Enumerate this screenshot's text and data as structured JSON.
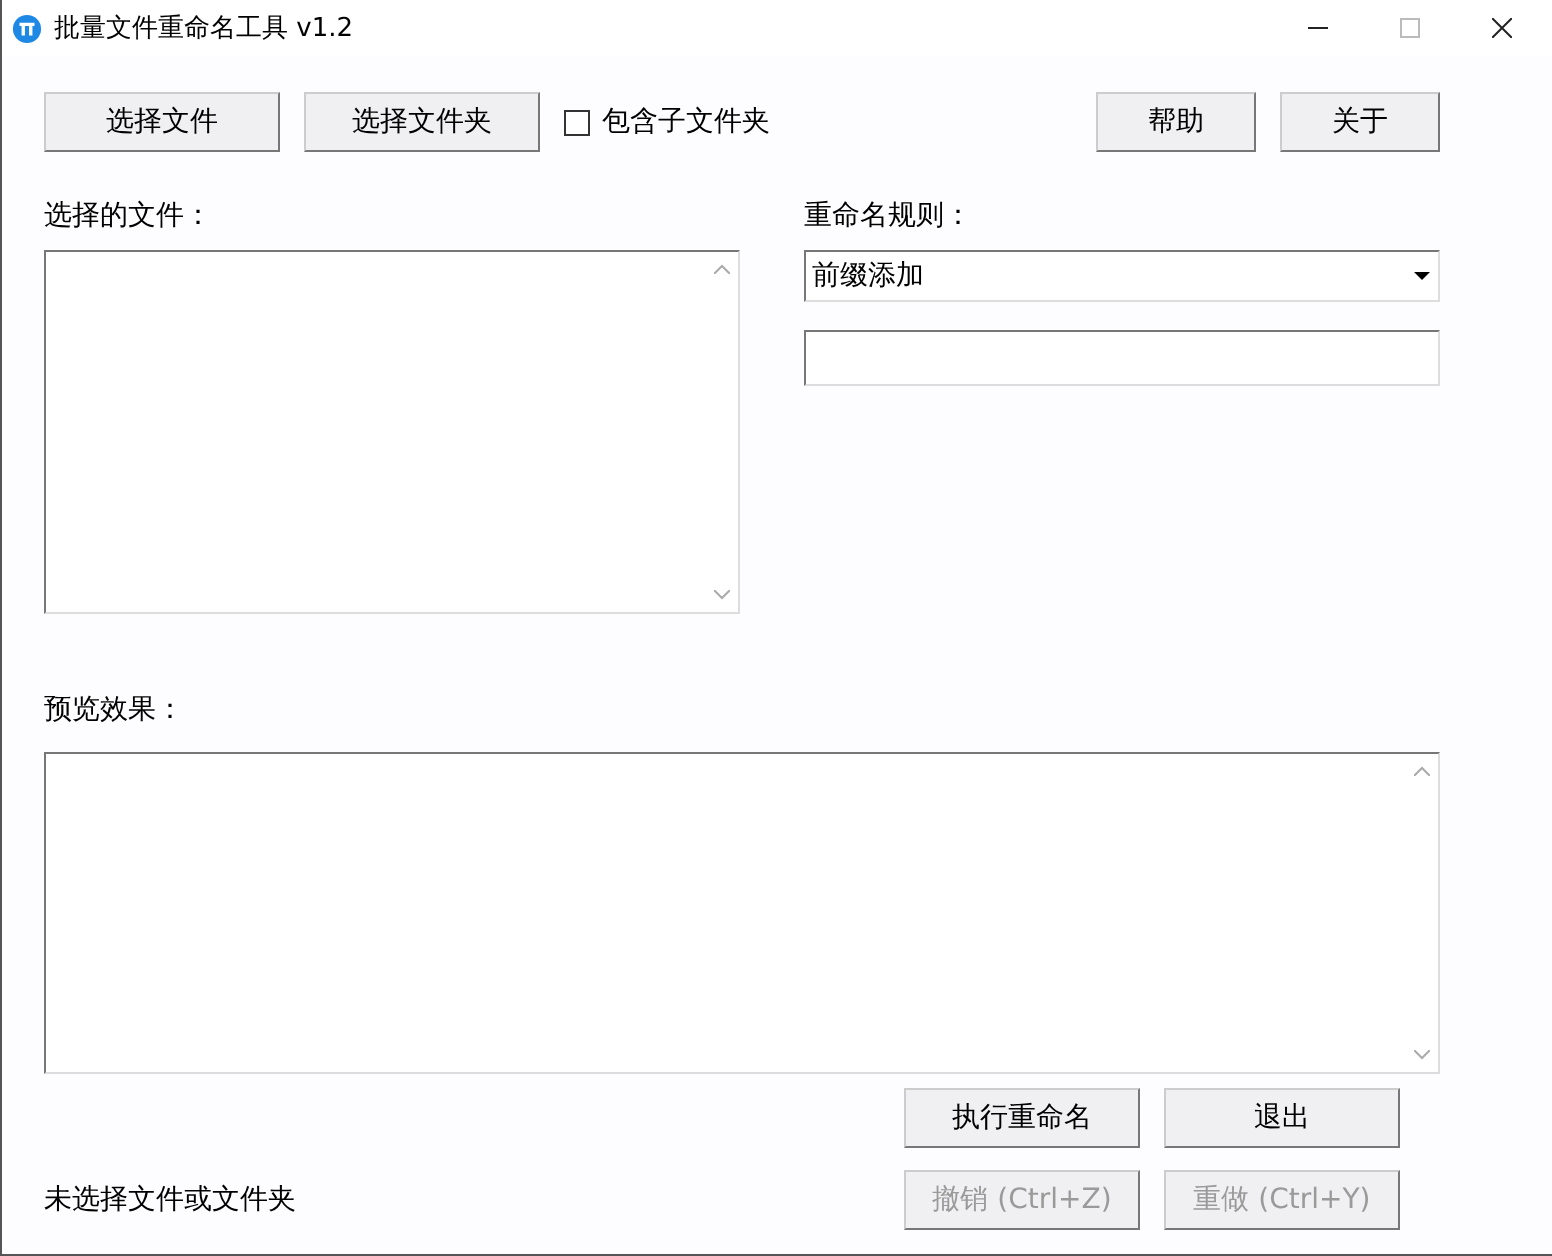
{
  "window": {
    "title": "批量文件重命名工具 v1.2"
  },
  "toolbar": {
    "buttons": [
      {
        "label": "选择文件"
      },
      {
        "label": "选择文件夹"
      }
    ],
    "checkbox": {
      "label": "包含子文件夹",
      "checked": false
    },
    "right_buttons": [
      {
        "label": "帮助"
      },
      {
        "label": "关于"
      }
    ]
  },
  "file_list": {
    "label": "选择的文件："
  },
  "rename_rule": {
    "label": "重命名规则：",
    "dropdown": {
      "value": "前缀添加"
    }
  },
  "preview": {
    "label": "预览效果："
  },
  "actions": [
    {
      "label": "执行重命名",
      "disabled": false
    },
    {
      "label": "退出",
      "disabled": false
    },
    {
      "label": "撤销 (Ctrl+Z)",
      "disabled": true
    },
    {
      "label": "重做 (Ctrl+Y)",
      "disabled": true
    }
  ],
  "status_bar": {
    "text": "未选择文件或文件夹"
  }
}
